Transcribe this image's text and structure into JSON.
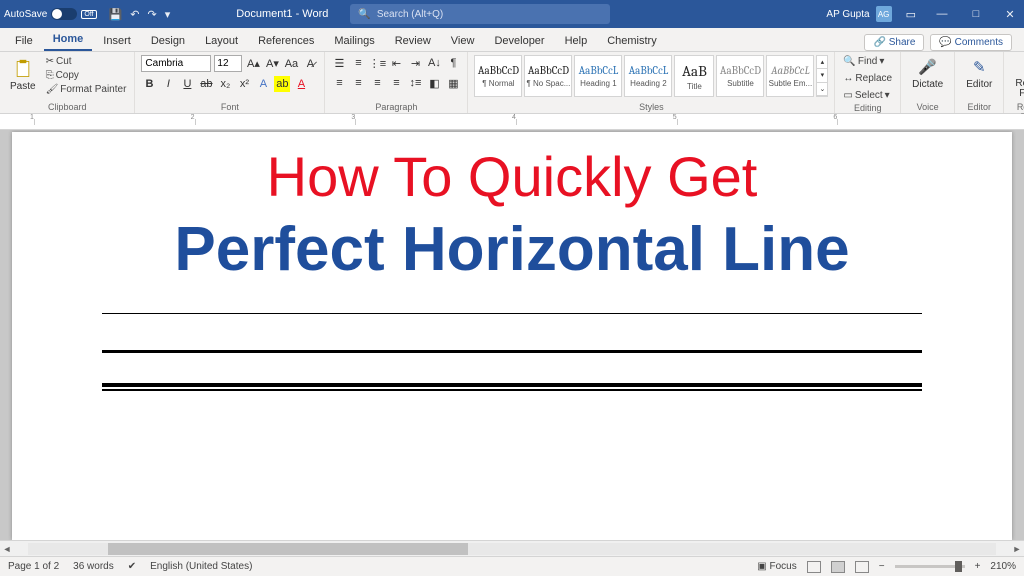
{
  "titlebar": {
    "autosave": "AutoSave",
    "autosave_state": "Off",
    "doc_title": "Document1 - Word",
    "search_placeholder": "Search (Alt+Q)",
    "user_name": "AP Gupta",
    "user_initials": "AG"
  },
  "menu": {
    "tabs": [
      "File",
      "Home",
      "Insert",
      "Design",
      "Layout",
      "References",
      "Mailings",
      "Review",
      "View",
      "Developer",
      "Help",
      "Chemistry"
    ],
    "active": "Home",
    "share": "Share",
    "comments": "Comments"
  },
  "ribbon": {
    "clipboard": {
      "paste": "Paste",
      "cut": "Cut",
      "copy": "Copy",
      "format_painter": "Format Painter",
      "label": "Clipboard"
    },
    "font": {
      "name": "Cambria",
      "size": "12",
      "label": "Font"
    },
    "paragraph": {
      "label": "Paragraph"
    },
    "styles": {
      "items": [
        {
          "preview": "AaBbCcD",
          "name": "¶ Normal"
        },
        {
          "preview": "AaBbCcD",
          "name": "¶ No Spac..."
        },
        {
          "preview": "AaBbCcL",
          "name": "Heading 1"
        },
        {
          "preview": "AaBbCcL",
          "name": "Heading 2"
        },
        {
          "preview": "AaB",
          "name": "Title"
        },
        {
          "preview": "AaBbCcD",
          "name": "Subtitle"
        },
        {
          "preview": "AaBbCcL",
          "name": "Subtle Em..."
        }
      ],
      "label": "Styles"
    },
    "editing": {
      "find": "Find",
      "replace": "Replace",
      "select": "Select",
      "label": "Editing"
    },
    "voice": {
      "dictate": "Dictate",
      "label": "Voice"
    },
    "editor": {
      "editor": "Editor",
      "label": "Editor"
    },
    "reuse": {
      "reuse": "Reuse Files",
      "label": "Reuse Files"
    }
  },
  "document": {
    "line1": "How To Quickly Get",
    "line2": "Perfect Horizontal Line"
  },
  "status": {
    "page": "Page 1 of 2",
    "words": "36 words",
    "lang": "English (United States)",
    "focus": "Focus",
    "zoom": "210%"
  },
  "ruler_marks": [
    "1",
    "2",
    "3",
    "4",
    "5",
    "6"
  ]
}
